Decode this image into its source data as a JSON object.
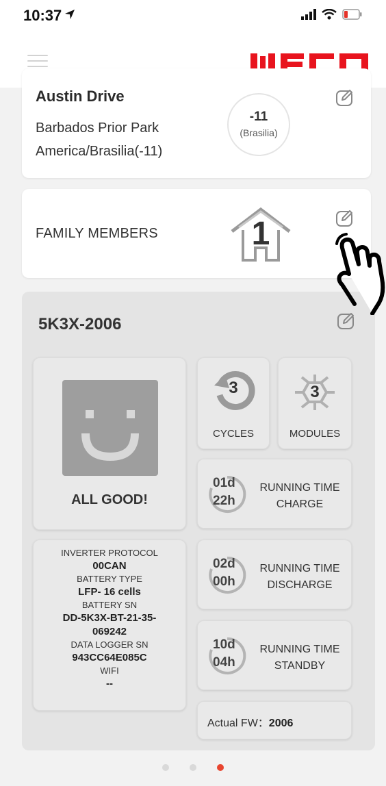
{
  "status_bar": {
    "time": "10:37"
  },
  "header": {
    "brand": "WECO"
  },
  "location": {
    "name": "Austin Drive",
    "address_line1": "Barbados Prior Park",
    "address_line2": "America/Brasilia(-11)",
    "timezone_offset": "-11",
    "timezone_name": "(Brasilia)"
  },
  "family": {
    "label": "FAMILY MEMBERS",
    "count": "1"
  },
  "device": {
    "title": "5K3X-2006",
    "status_text": "ALL GOOD!",
    "cycles": {
      "value": "3",
      "label": "CYCLES"
    },
    "modules": {
      "value": "3",
      "label": "MODULES"
    },
    "running": [
      {
        "days": "01d",
        "hours": "22h",
        "line1": "RUNNING TIME",
        "line2": "CHARGE"
      },
      {
        "days": "02d",
        "hours": "00h",
        "line1": "RUNNING TIME",
        "line2": "DISCHARGE"
      },
      {
        "days": "10d",
        "hours": "04h",
        "line1": "RUNNING TIME",
        "line2": "STANDBY"
      }
    ],
    "info": {
      "inverter_protocol_label": "INVERTER PROTOCOL",
      "inverter_protocol_value": "00CAN",
      "battery_type_label": "BATTERY TYPE",
      "battery_type_value": "LFP- 16 cells",
      "battery_sn_label": "BATTERY SN",
      "battery_sn_value_line1": "DD-5K3X-BT-21-35-",
      "battery_sn_value_line2": "069242",
      "data_logger_sn_label": "DATA LOGGER SN",
      "data_logger_sn_value": "943CC64E085C",
      "wifi_label": "WIFI",
      "wifi_value": "--"
    },
    "firmware": {
      "label": "Actual FW：",
      "value": "2006"
    }
  },
  "pagination": {
    "total": 3,
    "active_index": 2
  },
  "colors": {
    "brand_red": "#e8141e",
    "active_dot": "#e8452f",
    "panel_gray": "#e4e4e4"
  },
  "icons": [
    "location-arrow-icon",
    "signal-icon",
    "wifi-icon",
    "battery-icon",
    "menu-icon",
    "edit-icon",
    "clock-icon",
    "house-icon",
    "smiley-icon",
    "cycle-icon",
    "module-icon",
    "timer-ring-icon",
    "hand-pointer-icon"
  ]
}
